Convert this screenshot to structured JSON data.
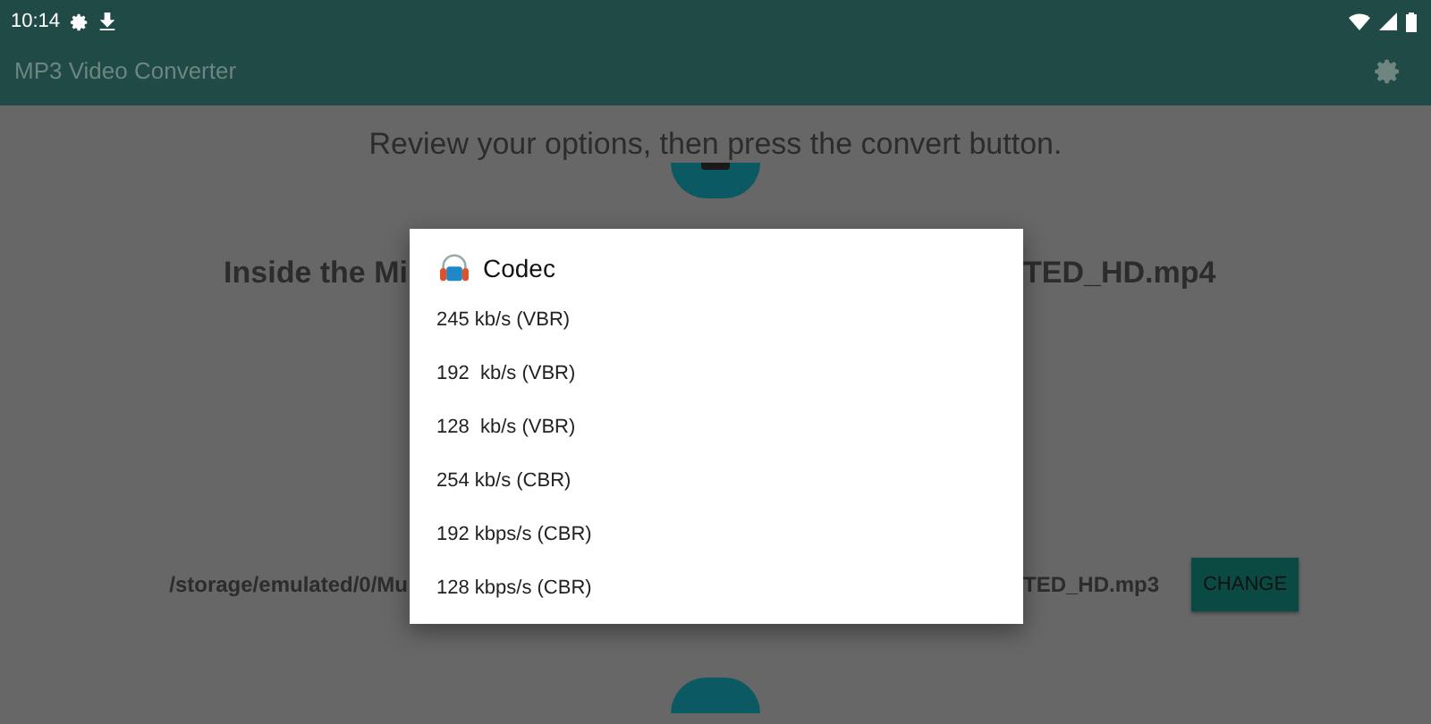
{
  "status_bar": {
    "time": "10:14"
  },
  "toolbar": {
    "title": "MP3 Video Converter"
  },
  "instruction": "Review your options, then press the convert button.",
  "input_file": {
    "left_part": "Inside the Mi",
    "right_part": "TED_HD.mp4"
  },
  "output_path": {
    "left_part": "/storage/emulated/0/Mu",
    "right_part": "TED_HD.mp3",
    "button": "CHANGE"
  },
  "dialog": {
    "title": "Codec",
    "options": [
      {
        "label": "245 kb/s (VBR)"
      },
      {
        "label": "192  kb/s (VBR)"
      },
      {
        "label": "128  kb/s (VBR)"
      },
      {
        "label": "254 kb/s (CBR)"
      },
      {
        "label": "192 kbps/s (CBR)"
      },
      {
        "label": "128 kbps/s (CBR)"
      }
    ]
  }
}
